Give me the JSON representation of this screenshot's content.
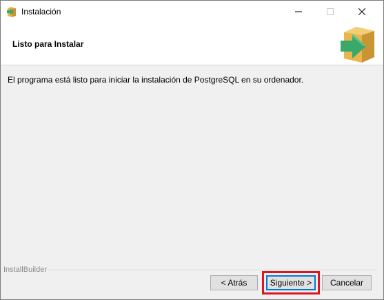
{
  "window": {
    "title": "Instalación"
  },
  "header": {
    "title": "Listo para Instalar"
  },
  "main": {
    "message": "El programa está listo para iniciar la instalación de PostgreSQL en su ordenador."
  },
  "footer": {
    "brand": "InstallBuilder"
  },
  "buttons": {
    "back": "< Atrás",
    "next": "Siguiente >",
    "cancel": "Cancelar"
  },
  "icons": {
    "app": "installer-box-arrow-icon",
    "minimize": "minimize-icon",
    "maximize": "maximize-icon",
    "close": "close-icon"
  },
  "colors": {
    "highlight": "#e0141e",
    "arrow": "#3aa86a",
    "box": "#e8b64c",
    "focus": "#0078d7"
  }
}
